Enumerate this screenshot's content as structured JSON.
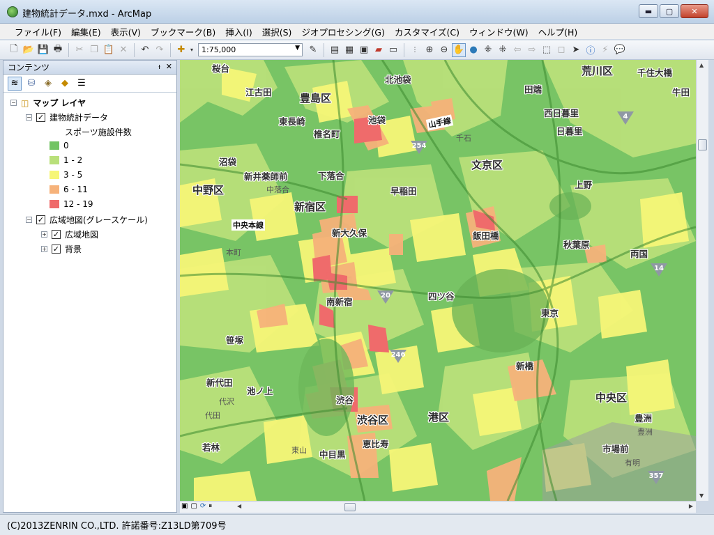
{
  "window": {
    "title": "建物統計データ.mxd - ArcMap",
    "minimize": "▬",
    "maximize": "▢",
    "close": "✕"
  },
  "menu": [
    "ファイル(F)",
    "編集(E)",
    "表示(V)",
    "ブックマーク(B)",
    "挿入(I)",
    "選択(S)",
    "ジオプロセシング(G)",
    "カスタマイズ(C)",
    "ウィンドウ(W)",
    "ヘルプ(H)"
  ],
  "toolbar": {
    "scale": "1:75,000"
  },
  "toc": {
    "title": "コンテンツ",
    "pin": "ᵼ",
    "close": "✕",
    "root": "マップ レイヤ",
    "layer1": {
      "name": "建物統計データ",
      "field": "スポーツ施設件数",
      "classes": [
        {
          "label": "0",
          "color": "#72c463"
        },
        {
          "label": "1 - 2",
          "color": "#b9e07a"
        },
        {
          "label": "3 - 5",
          "color": "#f6f677"
        },
        {
          "label": "6 - 11",
          "color": "#f6b27a"
        },
        {
          "label": "12 - 19",
          "color": "#ef6b6b"
        }
      ]
    },
    "group": {
      "name": "広域地図(グレースケール)",
      "children": [
        "広域地図",
        "背景"
      ]
    }
  },
  "map": {
    "wards": [
      "荒川区",
      "豊島区",
      "文京区",
      "中野区",
      "新宿区",
      "渋谷区",
      "港区",
      "中央区"
    ],
    "stations": [
      "桜台",
      "北池袋",
      "田端",
      "千住大橋",
      "江古田",
      "牛田",
      "池袋",
      "東長崎",
      "西日暮里",
      "椎名町",
      "日暮里",
      "沼袋",
      "新井薬師前",
      "下落合",
      "上野",
      "早稲田",
      "飯田橋",
      "新大久保",
      "秋葉原",
      "両国",
      "四ツ谷",
      "南新宿",
      "東京",
      "笹塚",
      "新橋",
      "新代田",
      "池ノ上",
      "渋谷",
      "恵比寿",
      "若林",
      "中目黒",
      "豊洲",
      "市場前"
    ],
    "lines": [
      "山手線",
      "中央本線"
    ],
    "minor": [
      "千石",
      "中落合",
      "本町",
      "代沢",
      "代田",
      "東山",
      "豊洲",
      "有明"
    ],
    "routes": [
      "4",
      "254",
      "14",
      "20",
      "246",
      "357"
    ]
  },
  "status": {
    "copyright": "(C)2013ZENRIN CO.,LTD. 許諾番号:Z13LD第709号"
  }
}
